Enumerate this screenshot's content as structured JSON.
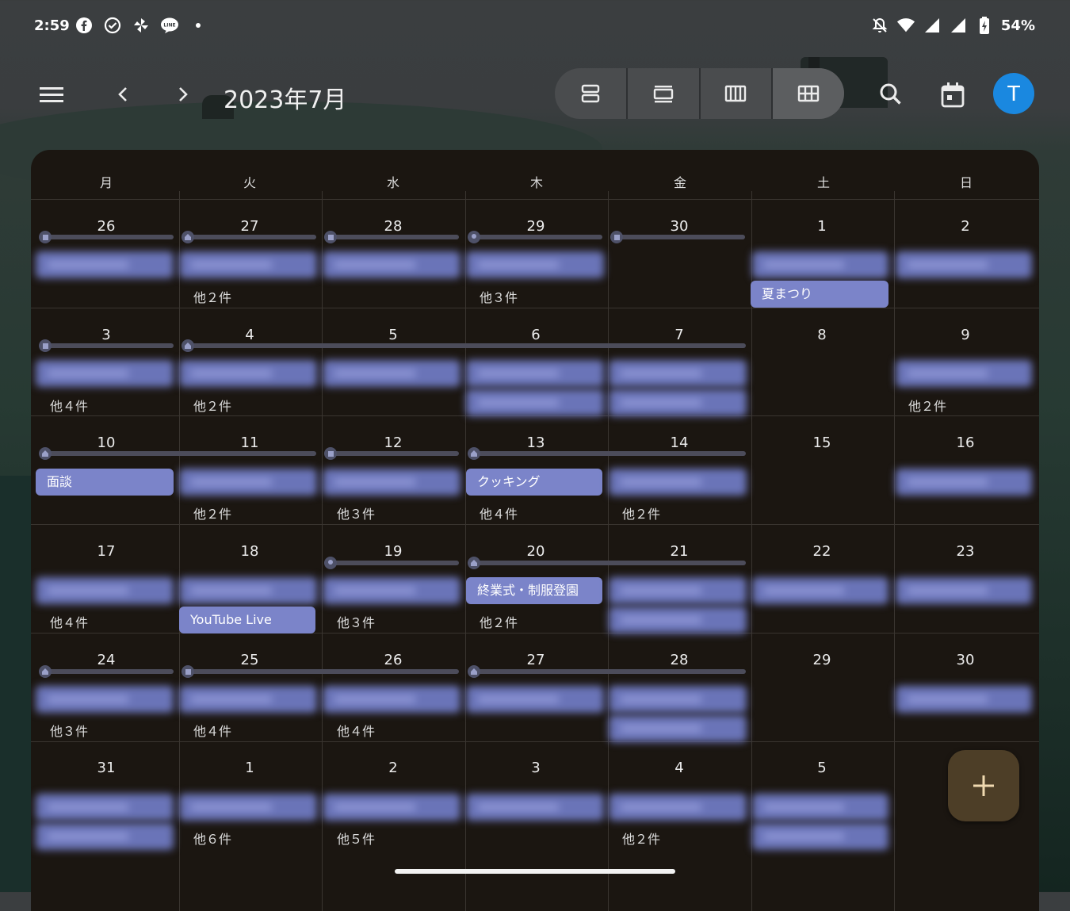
{
  "status_bar": {
    "time": "2:59",
    "battery": "54%"
  },
  "header": {
    "month_title": "2023年7月",
    "avatar_letter": "T"
  },
  "weekdays": [
    "月",
    "火",
    "水",
    "木",
    "金",
    "土",
    "日"
  ],
  "weeks": [
    {
      "days": [
        "26",
        "27",
        "28",
        "29",
        "30",
        "1",
        "2"
      ]
    },
    {
      "days": [
        "3",
        "4",
        "5",
        "6",
        "7",
        "8",
        "9"
      ]
    },
    {
      "days": [
        "10",
        "11",
        "12",
        "13",
        "14",
        "15",
        "16"
      ]
    },
    {
      "days": [
        "17",
        "18",
        "19",
        "20",
        "21",
        "22",
        "23"
      ]
    },
    {
      "days": [
        "24",
        "25",
        "26",
        "27",
        "28",
        "29",
        "30"
      ]
    },
    {
      "days": [
        "31",
        "1",
        "2",
        "3",
        "4",
        "5",
        ""
      ]
    }
  ],
  "events": {
    "natsumatsuri": "夏まつり",
    "mendan": "面談",
    "cooking": "クッキング",
    "shugyoshiki": "終業式・制服登園",
    "youtube_live": "YouTube Live"
  },
  "more_labels": {
    "w1_tue": "他２件",
    "w1_thu": "他３件",
    "w2_mon": "他４件",
    "w2_tue": "他２件",
    "w2_sun": "他２件",
    "w3_tue": "他２件",
    "w3_wed": "他３件",
    "w3_thu": "他４件",
    "w3_fri": "他２件",
    "w4_mon": "他４件",
    "w4_wed": "他３件",
    "w4_thu": "他２件",
    "w5_mon": "他３件",
    "w5_tue": "他４件",
    "w5_wed": "他４件",
    "w6_tue": "他６件",
    "w6_wed": "他５件",
    "w6_fri": "他２件"
  },
  "colors": {
    "event": "#7b84c9",
    "avatar": "#1a88e0",
    "fab": "#4d3e27"
  }
}
